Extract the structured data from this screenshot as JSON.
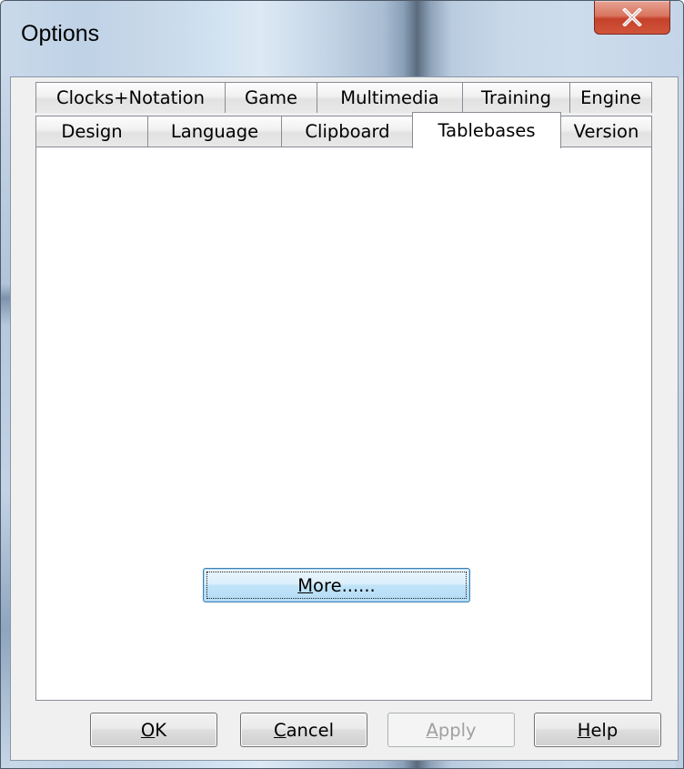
{
  "window": {
    "title": "Options",
    "close_glyph": "x"
  },
  "tabs": {
    "back_row": [
      {
        "label": "Clocks+Notation"
      },
      {
        "label": "Game"
      },
      {
        "label": "Multimedia"
      },
      {
        "label": "Training"
      },
      {
        "label": "Engine"
      }
    ],
    "front_row": [
      {
        "label": "Design"
      },
      {
        "label": "Language"
      },
      {
        "label": "Clipboard"
      },
      {
        "label": "Tablebases",
        "active": true
      },
      {
        "label": "Version"
      }
    ]
  },
  "panel": {
    "more_button": {
      "mnemonic": "M",
      "rest": "ore......"
    }
  },
  "buttons": {
    "ok": {
      "mnemonic": "O",
      "rest": "K"
    },
    "cancel": {
      "mnemonic": "C",
      "rest": "ancel"
    },
    "apply": {
      "mnemonic": "A",
      "rest": "pply",
      "enabled": false
    },
    "help": {
      "mnemonic": "H",
      "rest": "elp"
    }
  },
  "colors": {
    "close_button": "#c5412a",
    "focused_button_border": "#3c7fb1",
    "dialog_background": "#f0f0f0"
  }
}
